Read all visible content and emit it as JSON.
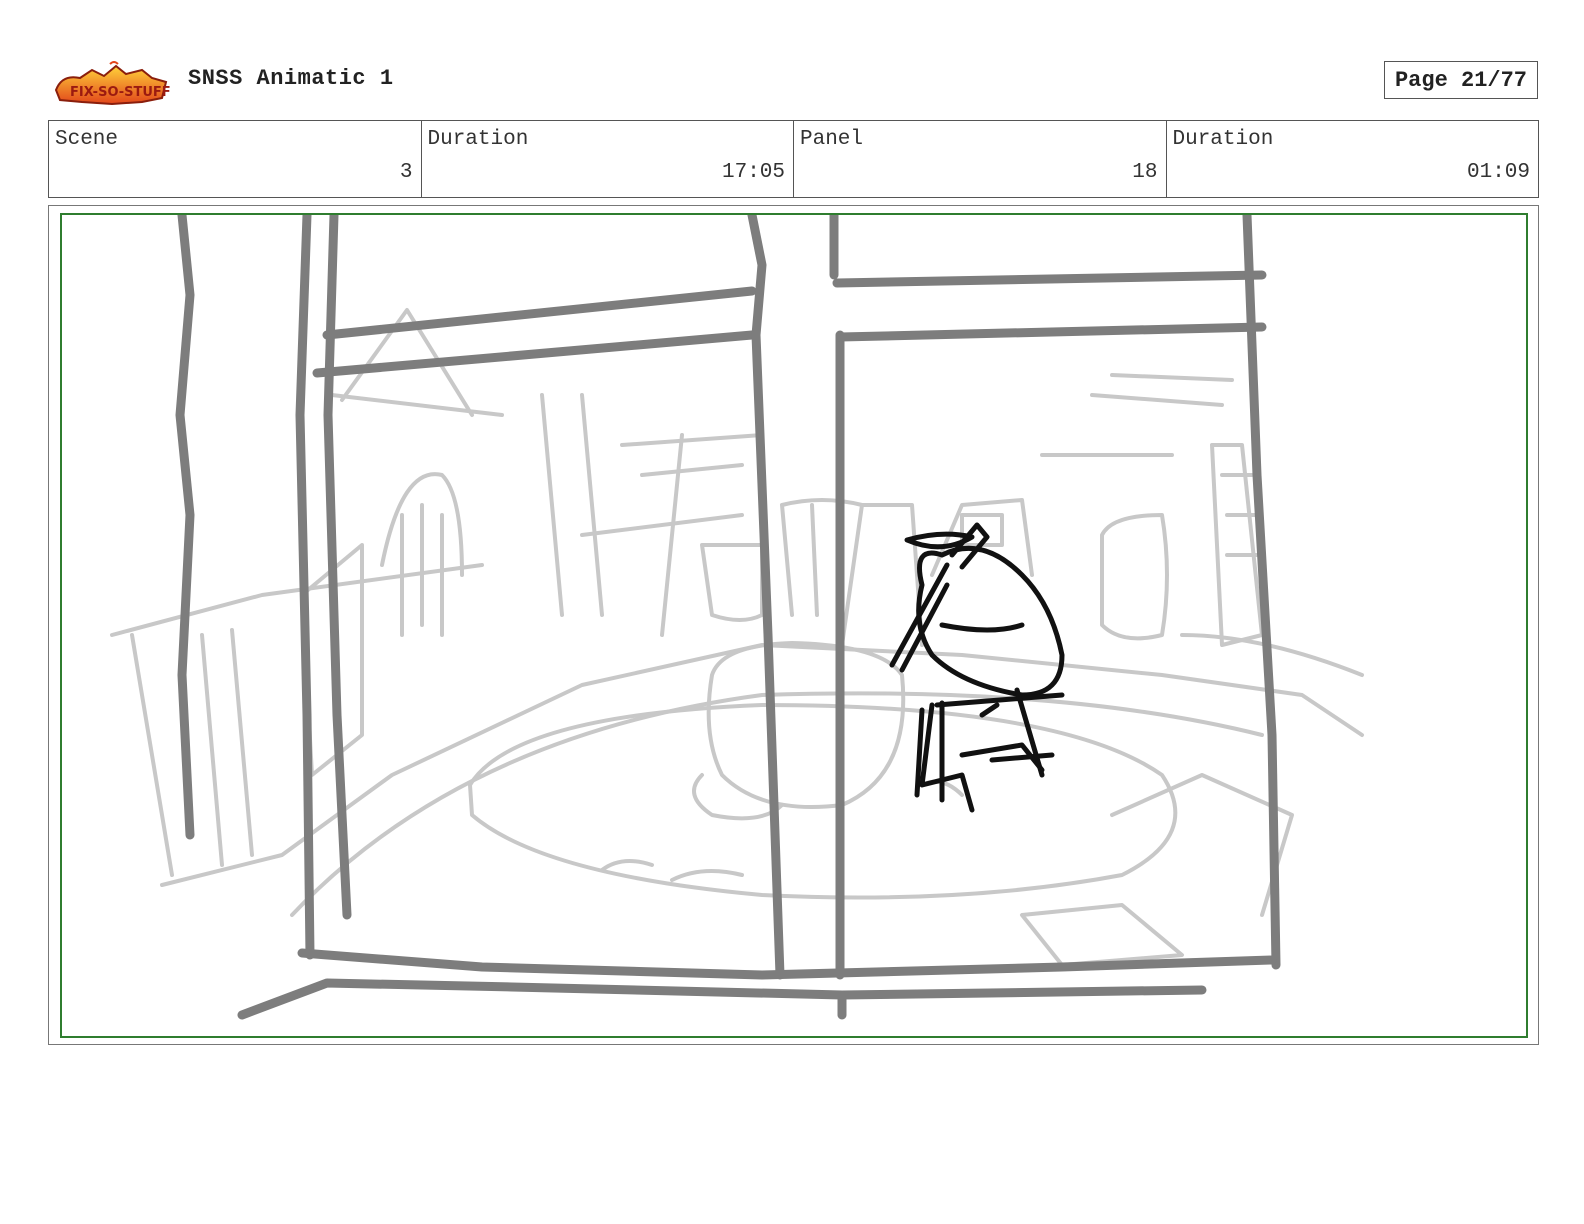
{
  "header": {
    "logo_text": "Sir Fix-So-Stuff",
    "title": "SNSS Animatic 1",
    "page_label": "Page 21/77"
  },
  "info": {
    "scene_label": "Scene",
    "scene_value": "3",
    "scene_duration_label": "Duration",
    "scene_duration_value": "17:05",
    "panel_label": "Panel",
    "panel_value": "18",
    "panel_duration_label": "Duration",
    "panel_duration_value": "01:09"
  },
  "colors": {
    "frame_border": "#2f7d2f",
    "sketch_light": "#c8c8c8",
    "sketch_mid": "#8a8a8a",
    "sketch_dark": "#111111"
  }
}
